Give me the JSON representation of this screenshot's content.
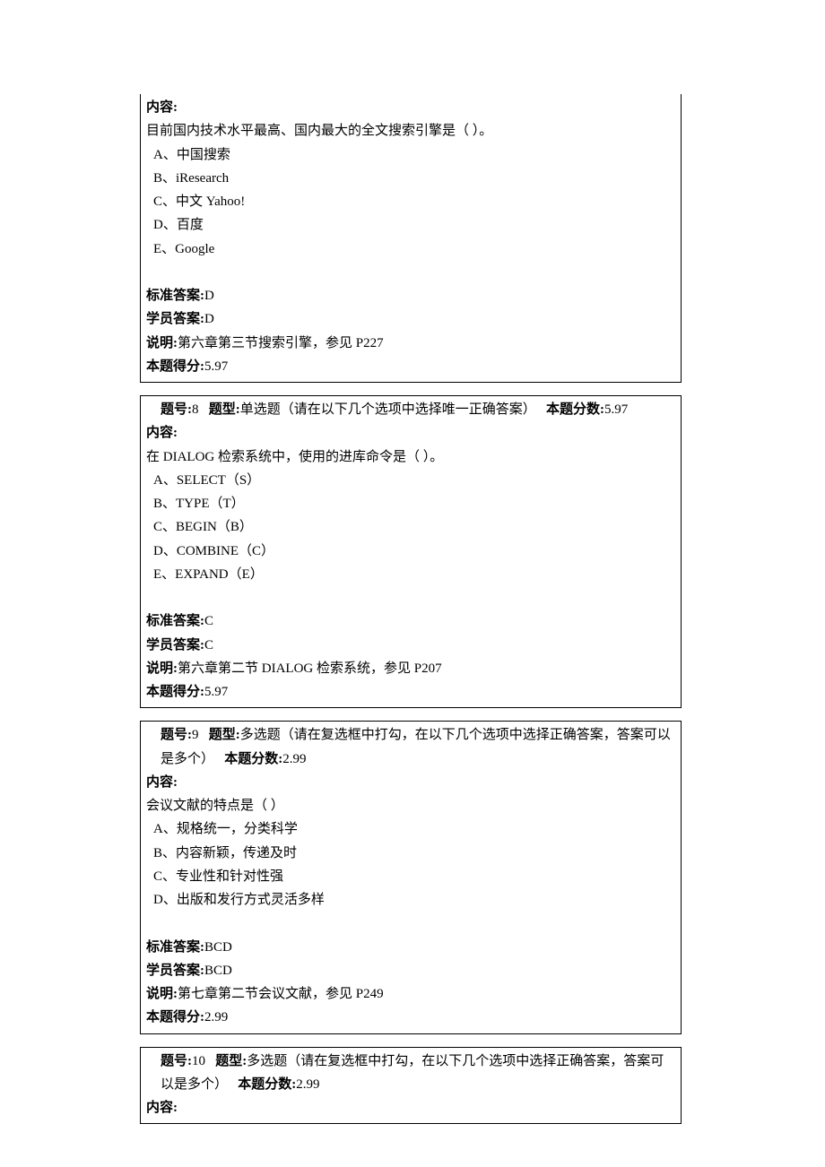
{
  "labels": {
    "content": "内容:",
    "std_answer": "标准答案:",
    "stu_answer": "学员答案:",
    "explain": "说明:",
    "score": "本题得分:",
    "qnum": "题号:",
    "qtype": "题型:",
    "qscore": "本题分数:"
  },
  "q7": {
    "prompt": "目前国内技术水平最高、国内最大的全文搜索引擎是（       ）。",
    "opts": [
      "A、中国搜索",
      "B、iResearch",
      "C、中文 Yahoo!",
      "D、百度",
      "E、Google"
    ],
    "std": "D",
    "stu": "D",
    "explain": "第六章第三节搜索引擎，参见 P227",
    "score": "5.97"
  },
  "q8": {
    "num": "8",
    "type": "单选题（请在以下几个选项中选择唯一正确答案）",
    "qscore": "5.97",
    "prompt": "在 DIALOG 检索系统中，使用的进库命令是（      ）。",
    "opts": [
      "A、SELECT（S）",
      "B、TYPE（T）",
      "C、BEGIN（B）",
      "D、COMBINE（C）",
      "E、EXPAND（E）"
    ],
    "std": "C",
    "stu": "C",
    "explain": "第六章第二节 DIALOG 检索系统，参见 P207",
    "score": "5.97"
  },
  "q9": {
    "num": "9",
    "type": "多选题（请在复选框中打勾，在以下几个选项中选择正确答案，答案可以是多个）",
    "qscore": "2.99",
    "prompt": "会议文献的特点是（ ）",
    "opts": [
      "A、规格统一，分类科学",
      "B、内容新颖，传递及时",
      "C、专业性和针对性强",
      "D、出版和发行方式灵活多样"
    ],
    "std": "BCD",
    "stu": "BCD",
    "explain": "第七章第二节会议文献，参见 P249",
    "score": "2.99"
  },
  "q10": {
    "num": "10",
    "type": "多选题（请在复选框中打勾，在以下几个选项中选择正确答案，答案可以是多个）",
    "qscore": "2.99"
  }
}
